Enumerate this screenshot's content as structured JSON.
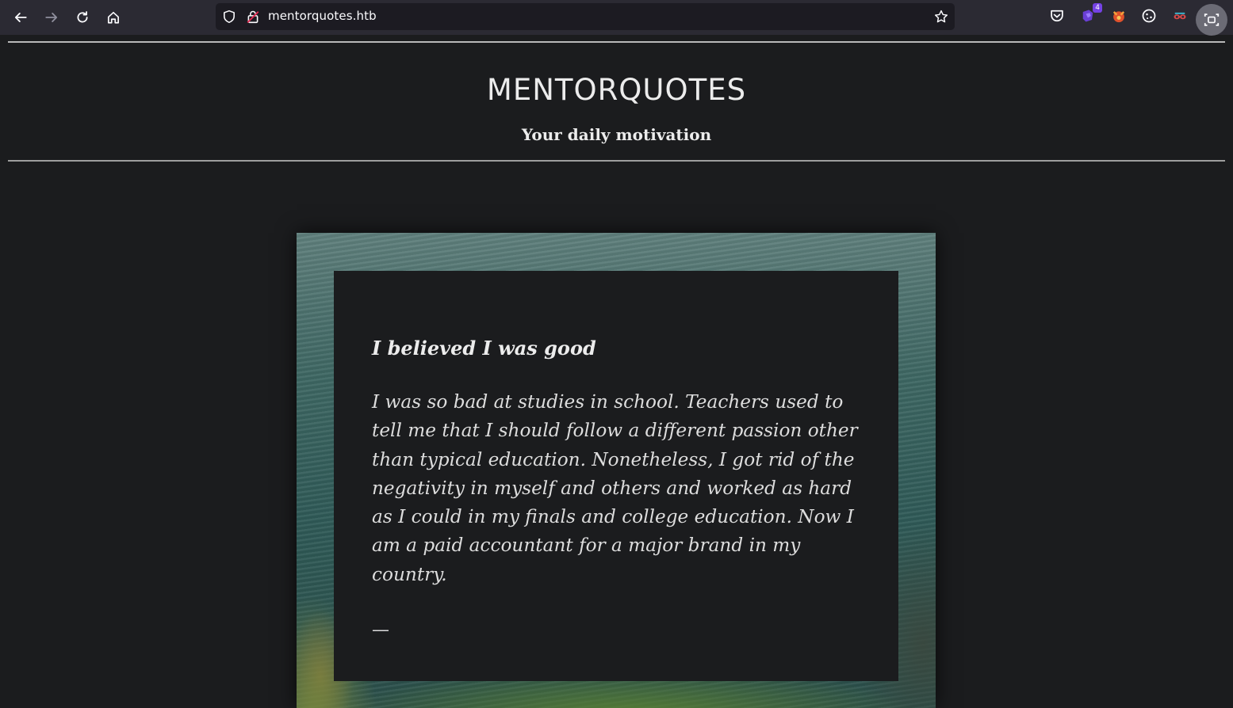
{
  "browser": {
    "url": "mentorquotes.htb",
    "extension_badge": "4",
    "icons": {
      "back": "arrow-left-icon",
      "forward": "arrow-right-icon",
      "reload": "reload-icon",
      "home": "home-icon",
      "shield": "shield-icon",
      "lock": "lock-icon",
      "bookmark": "star-icon",
      "pocket": "pocket-icon",
      "ext1": "purple-extension-icon",
      "ext2": "fox-extension-icon",
      "ext3": "cookie-icon",
      "ext4": "mask-extension-icon",
      "profile": "screenshot-icon"
    }
  },
  "header": {
    "title": "MENTORQUOTES",
    "subtitle": "Your daily motivation"
  },
  "quote": {
    "title": "I believed I was good",
    "body": "I was so bad at studies in school. Teachers used to tell me that I should follow a different passion other than typical education. Nonetheless, I got rid of the negativity in myself and others and worked as hard as I could in my finals and college education. Now I am a paid accountant for a major brand in my country.",
    "author_dash": "—"
  },
  "colors": {
    "page_bg": "#1b1c1e",
    "toolbar_bg": "#2b2a33",
    "text": "#ececec"
  }
}
